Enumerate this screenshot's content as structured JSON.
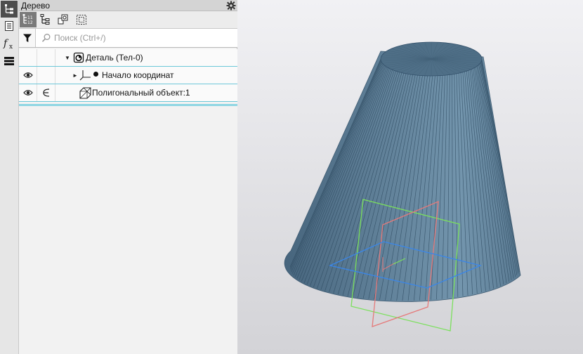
{
  "panel": {
    "title": "Дерево"
  },
  "search": {
    "placeholder": "Поиск (Ctrl+/)"
  },
  "tree": {
    "items": [
      {
        "label": "Деталь (Тел-0)"
      },
      {
        "label": "Начало координат"
      },
      {
        "label": "Полигональный объект:1"
      }
    ]
  },
  "icons": {
    "strip": [
      "tree-icon",
      "properties-icon",
      "fx-variables-icon",
      "layers-menu-icon"
    ],
    "toolbar": [
      "tree-structure-icon",
      "tree-hierarchy-icon",
      "components-icon",
      "selection-set-icon"
    ]
  },
  "colors": {
    "model": "#5f7f98",
    "plane_green": "#7be05c",
    "plane_red": "#e57a7a",
    "plane_blue": "#3a86e8",
    "selection": "#6cc7d8"
  }
}
